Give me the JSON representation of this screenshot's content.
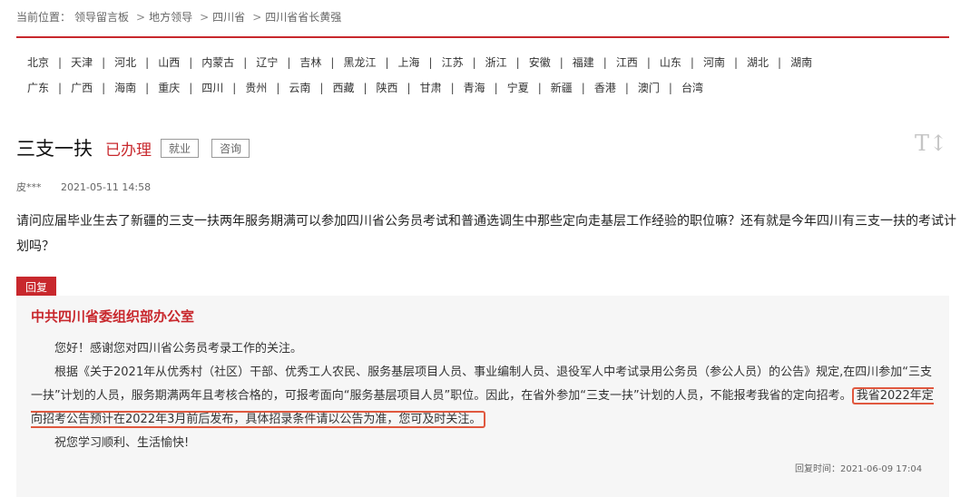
{
  "breadcrumb": {
    "prefix": "当前位置：",
    "items": [
      "领导留言板",
      "地方领导",
      "四川省",
      "四川省省长黄强"
    ],
    "separator": ">"
  },
  "regions": {
    "row1": [
      "北京",
      "天津",
      "河北",
      "山西",
      "内蒙古",
      "辽宁",
      "吉林",
      "黑龙江",
      "上海",
      "江苏",
      "浙江",
      "安徽",
      "福建",
      "江西",
      "山东",
      "河南",
      "湖北",
      "湖南"
    ],
    "row2": [
      "广东",
      "广西",
      "海南",
      "重庆",
      "四川",
      "贵州",
      "云南",
      "西藏",
      "陕西",
      "甘肃",
      "青海",
      "宁夏",
      "新疆",
      "香港",
      "澳门",
      "台湾"
    ],
    "separator": "|"
  },
  "message": {
    "title": "三支一扶",
    "status": "已办理",
    "tags": [
      "就业",
      "咨询"
    ],
    "author": "皮***",
    "time": "2021-05-11 14:58",
    "question": "请问应届毕业生去了新疆的三支一扶两年服务期满可以参加四川省公务员考试和普通选调生中那些定向走基层工作经验的职位嘛？还有就是今年四川有三支一扶的考试计划吗？",
    "font_toggle": "T↕"
  },
  "reply": {
    "badge": "回复",
    "from": "中共四川省委组织部办公室",
    "greeting": "您好！感谢您对四川省公务员考录工作的关注。",
    "para2_lead": "根据《关于2021年从优秀村（社区）干部、优秀工人农民、服务基层项目人员、事业编制人员、退役军人中考试录用公务员（参公人员）的公告》规定,在四川参加“三支一扶”计划的人员，服务期满两年且考核合格的，可报考面向“服务基层项目人员”职位。因此，在省外参加“三支一扶”计划的人员，不能报考我省的定向招考。",
    "para2_highlight": "我省2022年定向招考公告预计在2022年3月前后发布，具体招录条件请以公告为准，您可及时关注。",
    "closing": "祝您学习顺利、生活愉快!",
    "time_label": "回复时间：",
    "time": "2021-06-09 17:04"
  },
  "colors": {
    "accent": "#c8282d",
    "highlight_border": "#e0583f",
    "reply_bg": "#f6f6f6"
  }
}
